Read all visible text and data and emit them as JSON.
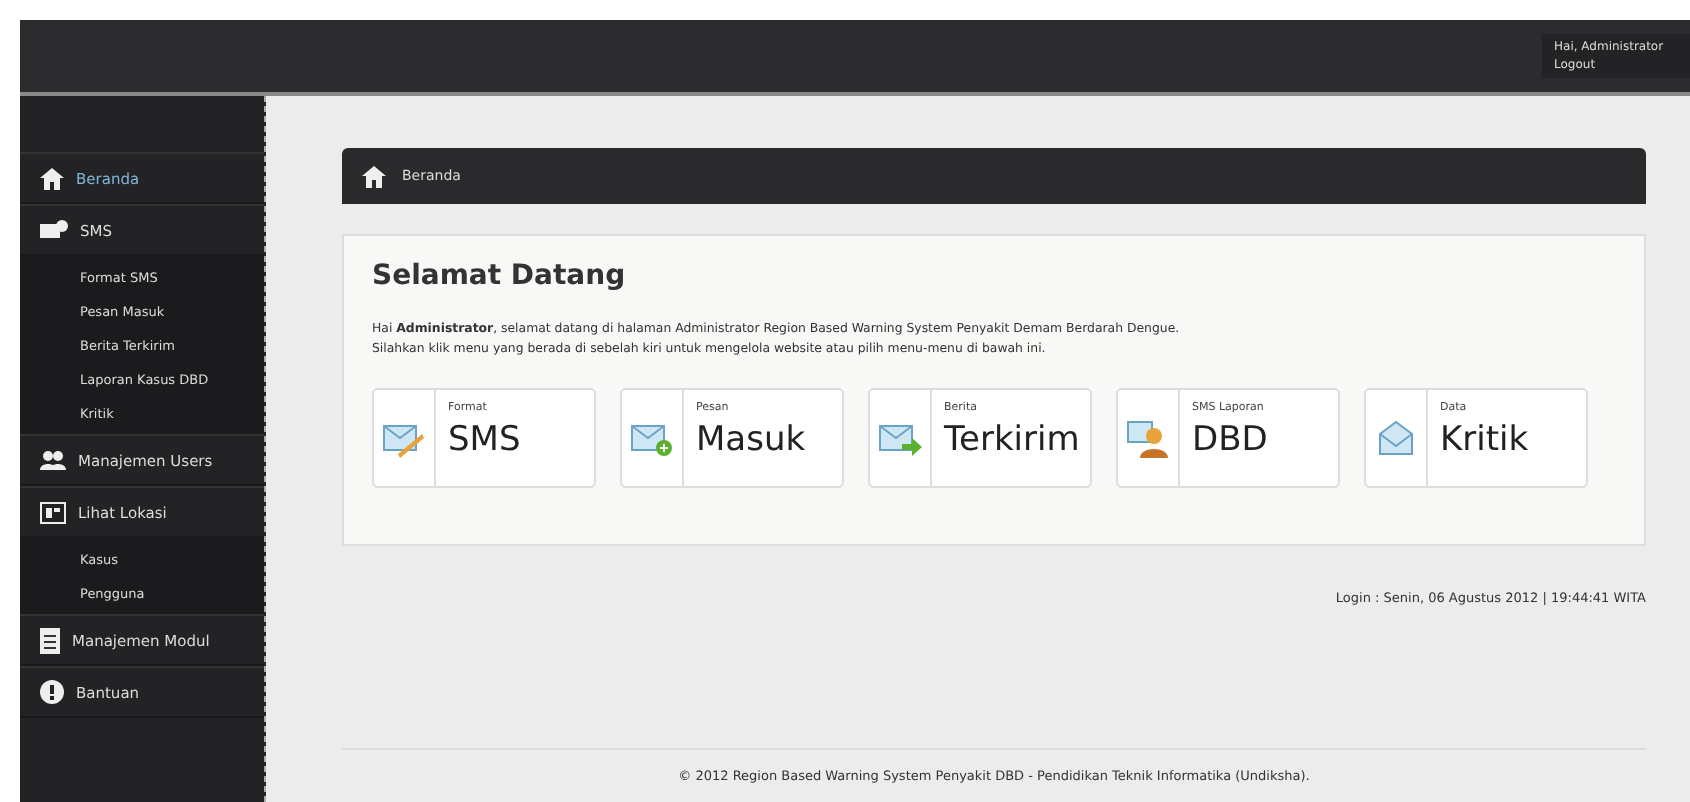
{
  "header": {
    "greeting": "Hai, Administrator",
    "logout": "Logout"
  },
  "sidebar": {
    "items": [
      {
        "label": "Beranda",
        "kind": "home",
        "selected": true
      },
      {
        "label": "SMS",
        "kind": "mail",
        "selected": false,
        "children": [
          {
            "label": "Format SMS"
          },
          {
            "label": "Pesan Masuk"
          },
          {
            "label": "Berita Terkirim"
          },
          {
            "label": "Laporan Kasus DBD"
          },
          {
            "label": "Kritik"
          }
        ]
      },
      {
        "label": "Manajemen Users",
        "kind": "users",
        "selected": false
      },
      {
        "label": "Lihat Lokasi",
        "kind": "map",
        "selected": false,
        "children": [
          {
            "label": "Kasus"
          },
          {
            "label": "Pengguna"
          }
        ]
      },
      {
        "label": "Manajemen Modul",
        "kind": "doc",
        "selected": false
      },
      {
        "label": "Bantuan",
        "kind": "alert",
        "selected": false
      }
    ]
  },
  "breadcrumb": "Beranda",
  "welcome": {
    "title": "Selamat Datang",
    "lines": [
      "Hai **Administrator**, selamat datang di halaman Administrator Region Based Warning System Penyakit Demam Berdarah Dengue.",
      "Silahkan klik menu yang berada di sebelah kiri untuk mengelola website atau pilih menu-menu di bawah ini."
    ]
  },
  "shortcuts": [
    {
      "kind": "format",
      "small": "Format",
      "big": "SMS"
    },
    {
      "kind": "inbox",
      "small": "Pesan",
      "big": "Masuk"
    },
    {
      "kind": "sent",
      "small": "Berita",
      "big": "Terkirim"
    },
    {
      "kind": "report",
      "small": "SMS Laporan",
      "big": "DBD"
    },
    {
      "kind": "critic",
      "small": "Data",
      "big": "Kritik"
    }
  ],
  "login": "Login : Senin, 06 Agustus 2012 | 19:44:41 WITA",
  "footer": "© 2012 Region Based Warning System Penyakit DBD - Pendidikan Teknik Informatika (Undiksha)."
}
